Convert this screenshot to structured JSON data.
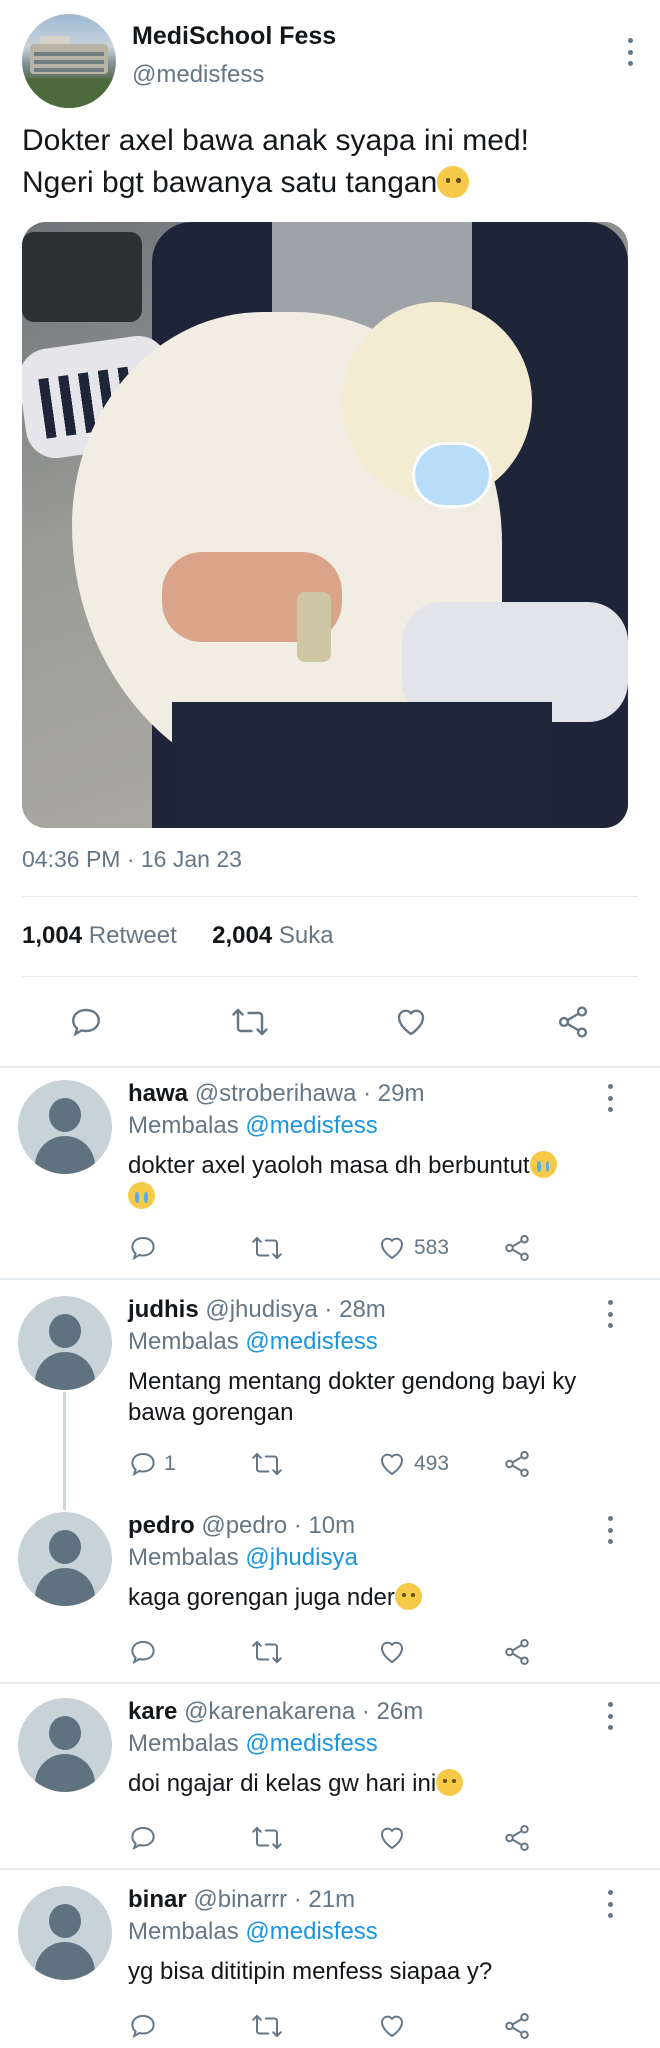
{
  "tweet": {
    "display_name": "MediSchool Fess",
    "handle": "@medisfess",
    "text_line1": "Dokter axel bawa anak syapa ini med!",
    "text_line2": "Ngeri bgt bawanya satu tangan",
    "timestamp": "04:36 PM · 16 Jan 23",
    "retweet_count": "1,004",
    "retweet_label": "Retweet",
    "like_count": "2,004",
    "like_label": "Suka"
  },
  "replies": [
    {
      "name": "hawa",
      "meta": "@stroberihawa · 29m",
      "reply_prefix": "Membalas",
      "reply_to": "@medisfess",
      "text": "dokter axel yaoloh masa dh berbuntut",
      "reply_count": "",
      "like_count": "583"
    },
    {
      "name": "judhis",
      "meta": "@jhudisya · 28m",
      "reply_prefix": "Membalas",
      "reply_to": "@medisfess",
      "text_line1": "Mentang mentang dokter gendong bayi ky",
      "text_line2": "bawa gorengan",
      "reply_count": "1",
      "like_count": "493"
    },
    {
      "name": "pedro",
      "meta": "@pedro · 10m",
      "reply_prefix": "Membalas",
      "reply_to": "@jhudisya",
      "text": "kaga gorengan juga nder",
      "reply_count": "",
      "like_count": ""
    },
    {
      "name": "kare",
      "meta": "@karenakarena · 26m",
      "reply_prefix": "Membalas",
      "reply_to": "@medisfess",
      "text": "doi ngajar di kelas gw hari ini",
      "reply_count": "",
      "like_count": ""
    },
    {
      "name": "binar",
      "meta": "@binarrr · 21m",
      "reply_prefix": "Membalas",
      "reply_to": "@medisfess",
      "text": "yg bisa dititipin menfess siapaa y?",
      "reply_count": "",
      "like_count": ""
    }
  ],
  "icons": [
    "reply-icon",
    "retweet-icon",
    "like-icon",
    "share-icon",
    "more-icon"
  ],
  "colors": {
    "link": "#1b95e0",
    "secondary_text": "#657786",
    "primary_text": "#14171a",
    "divider": "#e1e8ed"
  }
}
